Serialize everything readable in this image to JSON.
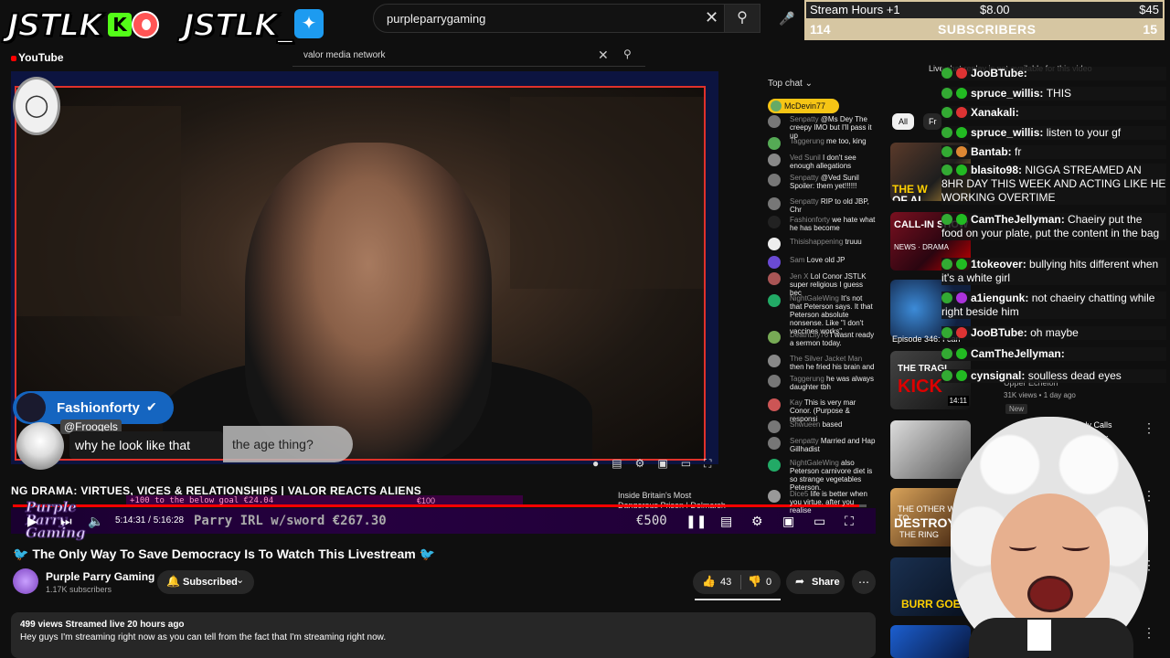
{
  "branding": {
    "left": "JSTLK",
    "right": "JSTLK_"
  },
  "search": {
    "value": "purpleparrygaming",
    "secondary_value": "valor media network"
  },
  "yt_logo": "YouTube",
  "stream_goal": {
    "hours_label": "Stream Hours +1",
    "amount": "$8.00",
    "target": "$45",
    "subs_count": "114",
    "subs_label": "SUBSCRIBERS",
    "subs_target": "15"
  },
  "video": {
    "fash_name": "Fashionforty",
    "froogels": "@Froogels",
    "chat_text": "why he look like that",
    "age_text": "the age thing?",
    "overlay_title": "NG   DRAMA: VIRTUES, VICES & RELATIONSHIPS | VALOR REACTS ALIENS",
    "goal_text": "+100 to the below goal  €24.04",
    "goal_100": "€100",
    "pp_logo": "Purple Parry Gaming",
    "pp_text": "Parry IRL w/sword €267.30",
    "pp_500": "€500",
    "time": "5:14:31 / 5:16:28",
    "inside": "Inside Britain's Most Dangerous Prison | Delmarsh | Two Part..."
  },
  "title": "The Only Way To Save Democracy Is To Watch This Livestream",
  "channel": {
    "name": "Purple Parry Gaming",
    "subs": "1.17K subscribers",
    "subscribed": "Subscribed"
  },
  "actions": {
    "likes": "43",
    "dislikes": "0",
    "share": "Share"
  },
  "description": {
    "meta": "499 views  Streamed live 20 hours ago",
    "text": "Hey guys I'm streaming right now as you can tell from the fact that I'm streaming right now."
  },
  "yt_chat": {
    "header": "Top chat",
    "pinned": "McDevin77",
    "messages": [
      {
        "name": "Senpatty",
        "text": "@Ms Dey The creepy IMO but I'll pass it up"
      },
      {
        "name": "Taggerung",
        "text": "me too, king"
      },
      {
        "name": "Ved Sunil",
        "text": "I don't see enough allegations"
      },
      {
        "name": "Senpatty",
        "text": "@Ved Sunil Spoiler: them yet!!!!!!"
      },
      {
        "name": "Senpatty",
        "text": "RIP to old JBP, Chr"
      },
      {
        "name": "Fashionforty",
        "text": "we hate what he has become"
      },
      {
        "name": "Thisishappening",
        "text": "truuu"
      },
      {
        "name": "Sam",
        "text": "Love old JP"
      },
      {
        "name": "Jen X",
        "text": "Lol Conor JSTLK super religious I guess bec"
      },
      {
        "name": "NightGaleWing",
        "text": "It's not that Peterson says. It that Peterson absolute nonsense. Like \"I don't vaccines works\""
      },
      {
        "name": "DeathLily76",
        "text": "I wasnt ready a sermon today."
      },
      {
        "name": "The Silver Jacket Man",
        "text": "then he fried his brain and"
      },
      {
        "name": "Taggerung",
        "text": "he was always daughter tbh"
      },
      {
        "name": "Kay",
        "text": "This is very mar Conor. (Purpose & responsi"
      },
      {
        "name": "Shwueen",
        "text": "based"
      },
      {
        "name": "Senpatty",
        "text": "Married and Hap Gillhadist"
      },
      {
        "name": "NightGaleWing",
        "text": "also Peterson carnivore diet is so strange vegetables Peterson."
      },
      {
        "name": "Dice5",
        "text": "life is better when you virtue. after you realise"
      }
    ]
  },
  "sidebar": {
    "replay_note": "Live chat replay is not available for this video",
    "chip_all": "All",
    "chip_from": "Fr",
    "reco": [
      {
        "title": "",
        "meta": ""
      },
      {
        "title": "Episode 346: I can",
        "meta": ""
      },
      {
        "title": "Upper Echelon",
        "meta": "31K views • 1 day ago",
        "badge": "New",
        "duration": "14:11"
      },
      {
        "title": "...ly Calls ...her, ...",
        "meta": ""
      }
    ]
  },
  "tw_chat": [
    {
      "user": "JooBTube:",
      "text": "",
      "color": "#fff"
    },
    {
      "user": "spruce_willis:",
      "text": "THIS",
      "color": "#fff"
    },
    {
      "user": "Xanakali:",
      "text": "",
      "color": "#fff"
    },
    {
      "user": "spruce_willis:",
      "text": "listen to your gf",
      "color": "#fff"
    },
    {
      "user": "Bantab:",
      "text": "fr",
      "color": "#fff"
    },
    {
      "user": "blasito98:",
      "text": "NIGGA STREAMED AN 8HR DAY THIS WEEK AND ACTING LIKE HE WORKING OVERTIME",
      "color": "#fff"
    },
    {
      "user": "CamTheJellyman:",
      "text": "Chaeiry put the food on your plate, put the content in the bag",
      "color": "#fff"
    },
    {
      "user": "1tokeover:",
      "text": "bullying hits different when it's a white girl",
      "color": "#fff"
    },
    {
      "user": "a1iengunk:",
      "text": "not chaeiry chatting while right beside him",
      "color": "#fff"
    },
    {
      "user": "JooBTube:",
      "text": "oh maybe",
      "color": "#fff"
    },
    {
      "user": "CamTheJellyman:",
      "text": "",
      "color": "#fff"
    },
    {
      "user": "cynsignal:",
      "text": "soulless dead eyes",
      "color": "#fff"
    }
  ]
}
